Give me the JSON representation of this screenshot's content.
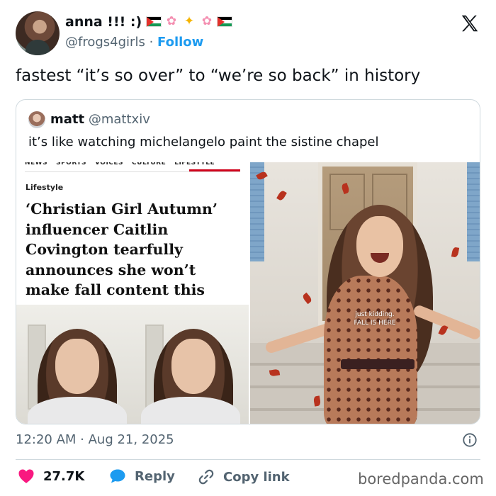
{
  "author": {
    "display_name": "anna !!! :)",
    "handle": "@frogs4girls",
    "separator": "·",
    "follow_label": "Follow",
    "name_emojis": [
      "palestine-flag",
      "cherry-blossom",
      "sparkles",
      "cherry-blossom",
      "palestine-flag"
    ]
  },
  "platform_logo": "x-logo",
  "tweet": {
    "text": "fastest “it’s so over” to “we’re so back” in history"
  },
  "quoted_tweet": {
    "display_name": "matt",
    "handle": "@mattxiv",
    "text": "it’s like watching michelangelo paint the sistine chapel",
    "article": {
      "nav_items": [
        "NEWS",
        "SPORTS",
        "VOICES",
        "CULTURE",
        "LIFESTYLE"
      ],
      "section": "Lifestyle",
      "headline": "‘Christian Girl Autumn’ influencer Caitlin Covington tearfully announces she won’t make fall content this year"
    },
    "video_caption_line1": "just kidding.",
    "video_caption_line2": "FALL IS HERE"
  },
  "timestamp": "12:20 AM · Aug 21, 2025",
  "actions": {
    "like_count": "27.7K",
    "reply_label": "Reply",
    "copy_label": "Copy link"
  },
  "watermark": "boredpanda.com",
  "colors": {
    "accent": "#1d9bf0",
    "like": "#f91880",
    "text_primary": "#0f1419",
    "text_secondary": "#536471",
    "border": "#cfd9de",
    "nav_underline": "#d0021b"
  }
}
